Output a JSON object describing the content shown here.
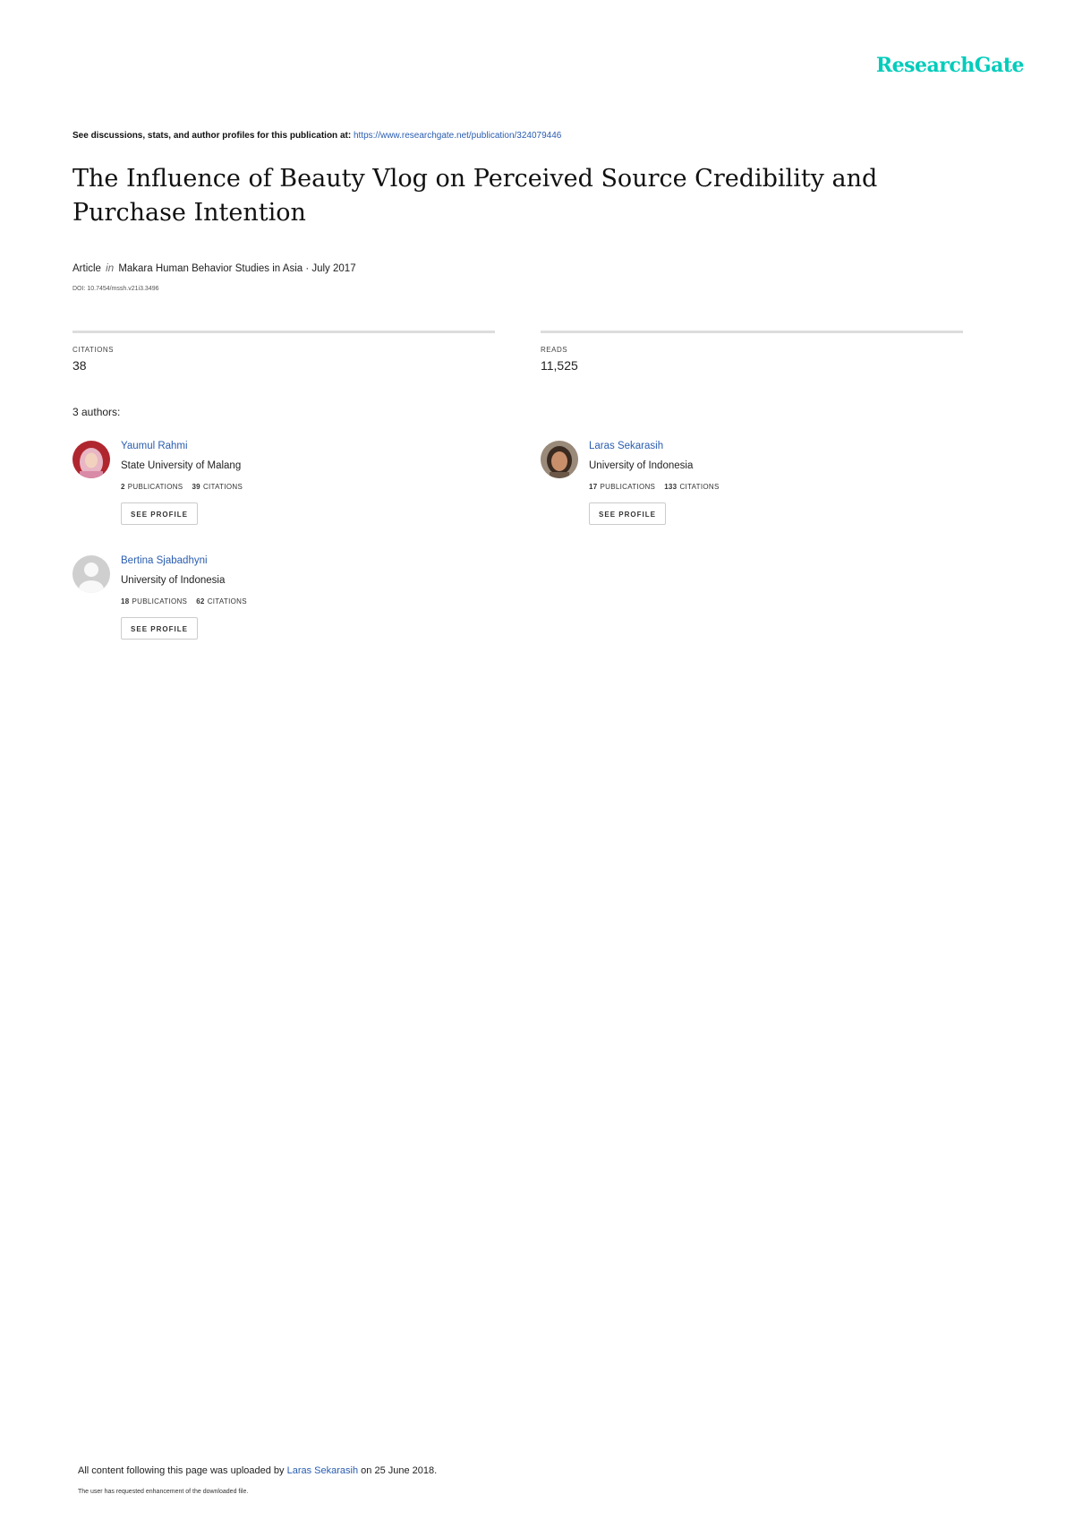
{
  "brand": {
    "logo_text": "ResearchGate",
    "color": "#00ccbb"
  },
  "discussions": {
    "prefix": "See discussions, stats, and author profiles for this publication at:",
    "url": "https://www.researchgate.net/publication/324079446"
  },
  "article": {
    "title": "The Influence of Beauty Vlog on Perceived Source Credibility and Purchase Intention",
    "type": "Article",
    "in_word": "in",
    "journal_date": "Makara Human Behavior Studies in Asia · July 2017",
    "doi": "DOI: 10.7454/mssh.v21i3.3496"
  },
  "stats": {
    "citations": {
      "label": "CITATIONS",
      "value": "38"
    },
    "reads": {
      "label": "READS",
      "value": "11,525"
    }
  },
  "authors_count": "3 authors:",
  "authors": [
    {
      "name": "Yaumul Rahmi",
      "institution": "State University of Malang",
      "publications_count": "2",
      "publications_label": "PUBLICATIONS",
      "citations_count": "39",
      "citations_label": "CITATIONS",
      "button": "SEE PROFILE",
      "avatar": "portrait-headscarf-icon"
    },
    {
      "name": "Laras Sekarasih",
      "institution": "University of Indonesia",
      "publications_count": "17",
      "publications_label": "PUBLICATIONS",
      "citations_count": "133",
      "citations_label": "CITATIONS",
      "button": "SEE PROFILE",
      "avatar": "portrait-photo-icon"
    },
    {
      "name": "Bertina Sjabadhyni",
      "institution": "University of Indonesia",
      "publications_count": "18",
      "publications_label": "PUBLICATIONS",
      "citations_count": "62",
      "citations_label": "CITATIONS",
      "button": "SEE PROFILE",
      "avatar": "default-user-icon"
    }
  ],
  "footer": {
    "upload_prefix": "All content following this page was uploaded by",
    "upload_user": "Laras Sekarasih",
    "upload_suffix": "on 25 June 2018.",
    "note": "The user has requested enhancement of the downloaded file."
  }
}
